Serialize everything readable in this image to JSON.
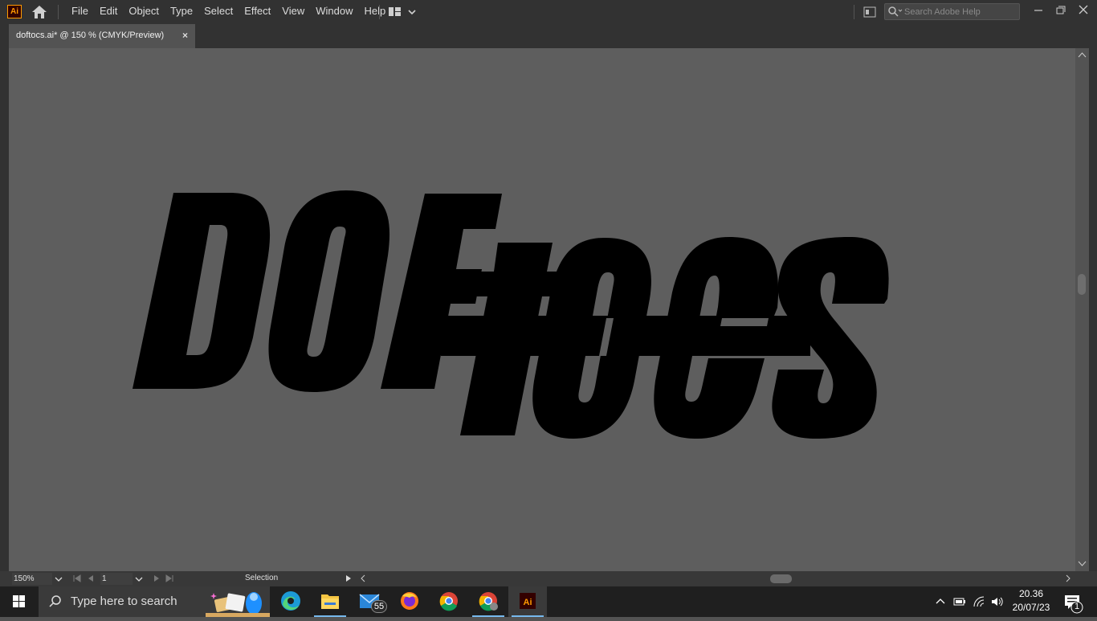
{
  "app": {
    "logo_text": "Ai",
    "menus": [
      "File",
      "Edit",
      "Object",
      "Type",
      "Select",
      "Effect",
      "View",
      "Window",
      "Help"
    ],
    "search_placeholder": "Search Adobe Help"
  },
  "document": {
    "tab_title": "doftocs.ai* @ 150 % (CMYK/Preview)",
    "close_glyph": "×"
  },
  "artwork": {
    "line1": "DOF",
    "line2": "tocs",
    "fill_color": "#000000"
  },
  "status": {
    "zoom": "150%",
    "artboard": "1",
    "tool": "Selection"
  },
  "taskbar": {
    "search_placeholder": "Type here to search",
    "mail_badge": "55",
    "time": "20.36",
    "date": "20/07/23",
    "notification_count": "1"
  },
  "colors": {
    "chrome": "#323232",
    "canvas": "#5e5e5e",
    "accent": "#ff9a00",
    "taskbar": "#1f1f1f"
  }
}
